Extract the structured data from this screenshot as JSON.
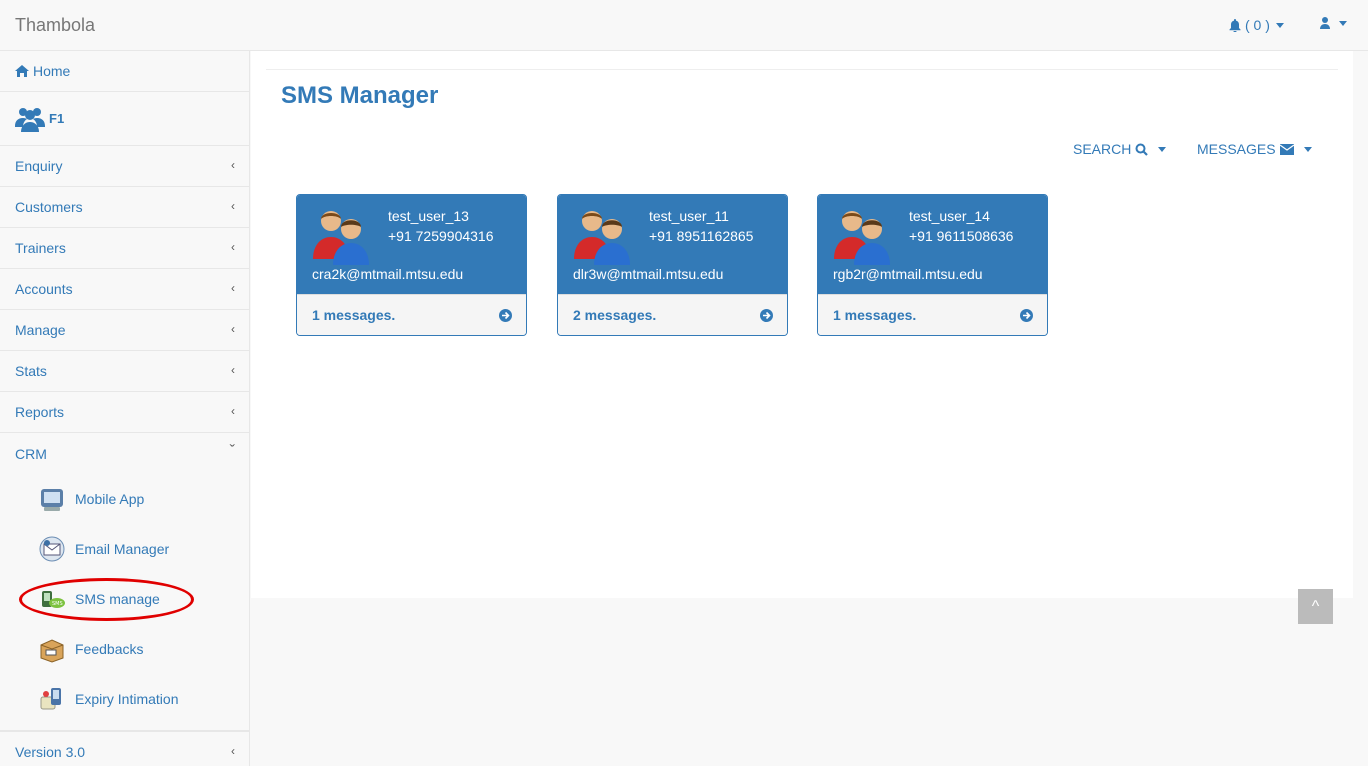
{
  "app": {
    "title": "Thambola"
  },
  "nav": {
    "notifications_label": "( 0 )"
  },
  "sidebar": {
    "home_label": "Home",
    "org_label": "F1",
    "items": [
      {
        "label": "Enquiry",
        "chevron": "‹"
      },
      {
        "label": "Customers",
        "chevron": "‹"
      },
      {
        "label": "Trainers",
        "chevron": "‹"
      },
      {
        "label": "Accounts",
        "chevron": "‹"
      },
      {
        "label": "Manage",
        "chevron": "‹"
      },
      {
        "label": "Stats",
        "chevron": "‹"
      },
      {
        "label": "Reports",
        "chevron": "‹"
      }
    ],
    "crm": {
      "label": "CRM",
      "chevron": "ˇ",
      "subitems": [
        {
          "label": "Mobile App"
        },
        {
          "label": "Email Manager"
        },
        {
          "label": "SMS manage"
        },
        {
          "label": "Feedbacks"
        },
        {
          "label": "Expiry Intimation"
        }
      ]
    },
    "version": {
      "label": "Version 3.0",
      "chevron": "‹"
    }
  },
  "main": {
    "title": "SMS Manager",
    "search_label": "SEARCH",
    "messages_label": "MESSAGES",
    "cards": [
      {
        "name": "test_user_13",
        "phone": "+91 7259904316",
        "email": "cra2k@mtmail.mtsu.edu",
        "count": "1 messages."
      },
      {
        "name": "test_user_11",
        "phone": "+91 8951162865",
        "email": "dlr3w@mtmail.mtsu.edu",
        "count": "2 messages."
      },
      {
        "name": "test_user_14",
        "phone": "+91 9611508636",
        "email": "rgb2r@mtmail.mtsu.edu",
        "count": "1 messages."
      }
    ]
  },
  "scroll_top": {
    "label": "^"
  },
  "colors": {
    "accent": "#337ab7",
    "highlight": "#e00000"
  }
}
